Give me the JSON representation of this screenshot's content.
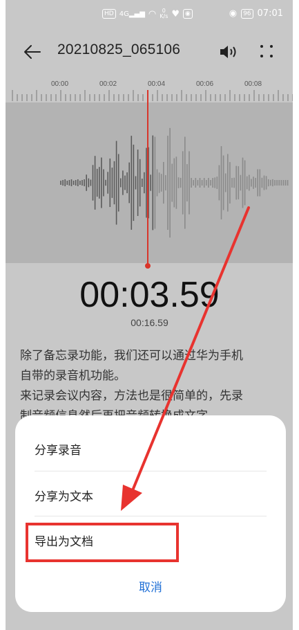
{
  "status_bar": {
    "network_badge": "HD",
    "signal_text": "4G",
    "speed_value": "0",
    "speed_unit": "K/s",
    "battery": "96",
    "time": "07:01"
  },
  "header": {
    "title": "20210825_065106"
  },
  "timeline": {
    "ticks": [
      "00:00",
      "00:02",
      "00:04",
      "00:06",
      "00:08"
    ]
  },
  "playback": {
    "current_time": "00:03.59",
    "total_time": "00:16.59"
  },
  "transcript": {
    "lines": [
      "除了备忘录功能，我们还可以通过华为手机",
      "自带的录音机功能。",
      "来记录会议内容，方法也是很简单的，先录",
      "制音频信息然后再把音频转换成文字"
    ]
  },
  "menu": {
    "items": [
      "分享录音",
      "分享为文本",
      "导出为文档"
    ],
    "cancel": "取消"
  },
  "colors": {
    "accent_blue": "#1f6fd6",
    "playhead_red": "#d9352a",
    "annotation_red": "#e8332f"
  }
}
